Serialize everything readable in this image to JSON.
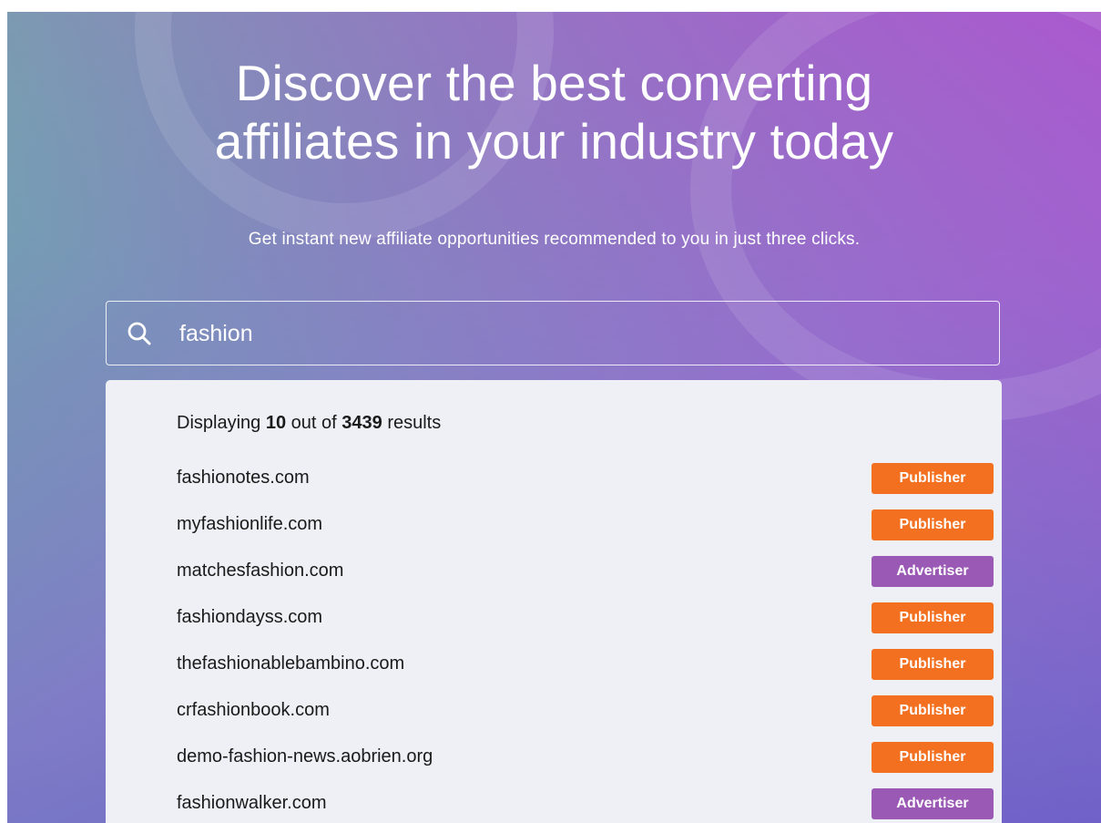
{
  "hero": {
    "title_line1": "Discover the best converting",
    "title_line2": "affiliates in your industry today",
    "subtitle": "Get instant new affiliate opportunities recommended to you in just three clicks."
  },
  "search": {
    "value": "fashion",
    "icon": "search-icon"
  },
  "results": {
    "prefix": "Displaying",
    "shown": "10",
    "middle": "out of",
    "total": "3439",
    "suffix": "results",
    "items": [
      {
        "domain": "fashionotes.com",
        "type": "Publisher"
      },
      {
        "domain": "myfashionlife.com",
        "type": "Publisher"
      },
      {
        "domain": "matchesfashion.com",
        "type": "Advertiser"
      },
      {
        "domain": "fashiondayss.com",
        "type": "Publisher"
      },
      {
        "domain": "thefashionablebambino.com",
        "type": "Publisher"
      },
      {
        "domain": "crfashionbook.com",
        "type": "Publisher"
      },
      {
        "domain": "demo-fashion-news.aobrien.org",
        "type": "Publisher"
      },
      {
        "domain": "fashionwalker.com",
        "type": "Advertiser"
      }
    ]
  },
  "colors": {
    "publisher": "#f37021",
    "advertiser": "#9b59b6"
  }
}
